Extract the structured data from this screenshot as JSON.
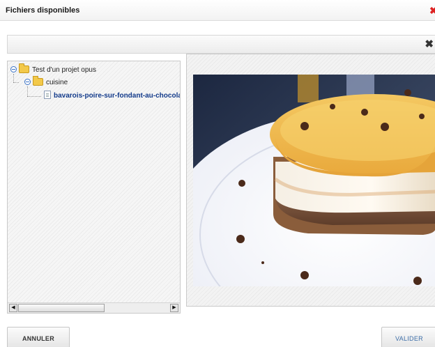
{
  "dialog": {
    "title": "Fichiers disponibles",
    "close_icon": "close-icon",
    "accent_color": "#d22222"
  },
  "toolbar": {
    "close_glyph": "✖"
  },
  "tree": {
    "nodes": [
      {
        "label": "Test d'un projet opus",
        "type": "folder",
        "level": 0,
        "expanded": true
      },
      {
        "label": "cuisine",
        "type": "folder",
        "level": 1,
        "expanded": true
      },
      {
        "label": "bavarois-poire-sur-fondant-au-chocolat",
        "type": "file",
        "level": 2,
        "selected": true
      }
    ],
    "scroll": {
      "left_arrow": "◀",
      "right_arrow": "▶"
    }
  },
  "preview": {
    "image_subject": "bavarois-dessert-photo"
  },
  "buttons": {
    "cancel_label": "ANNULER",
    "ok_label": "VALIDER"
  }
}
